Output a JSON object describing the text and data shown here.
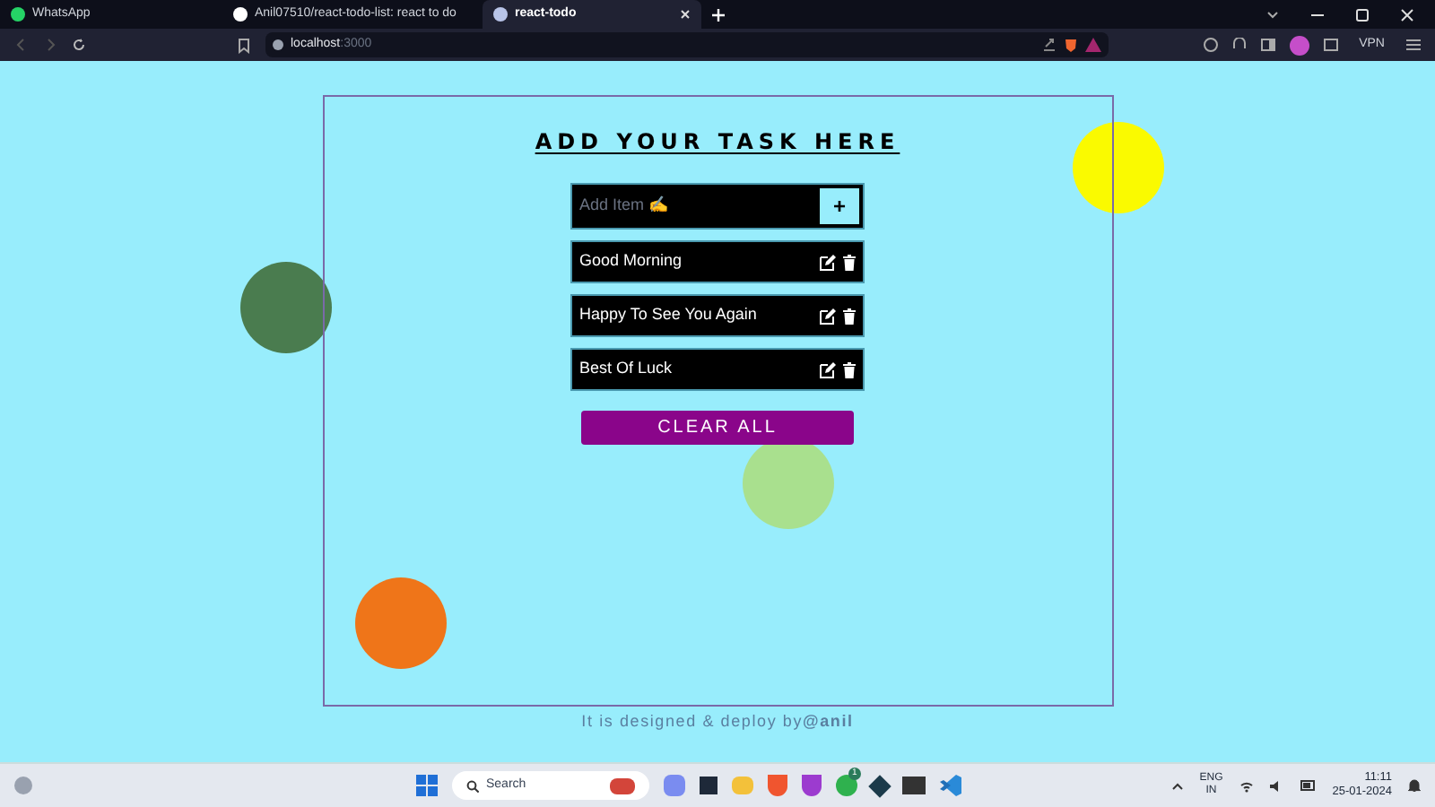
{
  "browser": {
    "tabs": [
      {
        "title": "WhatsApp",
        "selected": false
      },
      {
        "title": "Anil07510/react-todo-list: react to do",
        "selected": false
      },
      {
        "title": "react-todo",
        "selected": true
      }
    ],
    "address": {
      "host": "localhost",
      "port": ":3000"
    },
    "vpn": "VPN"
  },
  "app": {
    "heading": "ADD YOUR TASK HERE",
    "input": {
      "placeholder": "Add Item ✍️"
    },
    "add_button": "+",
    "items": [
      {
        "text": "Good Morning"
      },
      {
        "text": "Happy To See You Again"
      },
      {
        "text": "Best Of Luck"
      }
    ],
    "clear_button": "CLEAR ALL",
    "footer": "It is designed & deploy by**@anil**"
  },
  "taskbar": {
    "search_placeholder": "Search",
    "whatsapp_badge": "1",
    "language": "ENG",
    "region": "IN",
    "time": "11:11",
    "date": "25-01-2024"
  }
}
